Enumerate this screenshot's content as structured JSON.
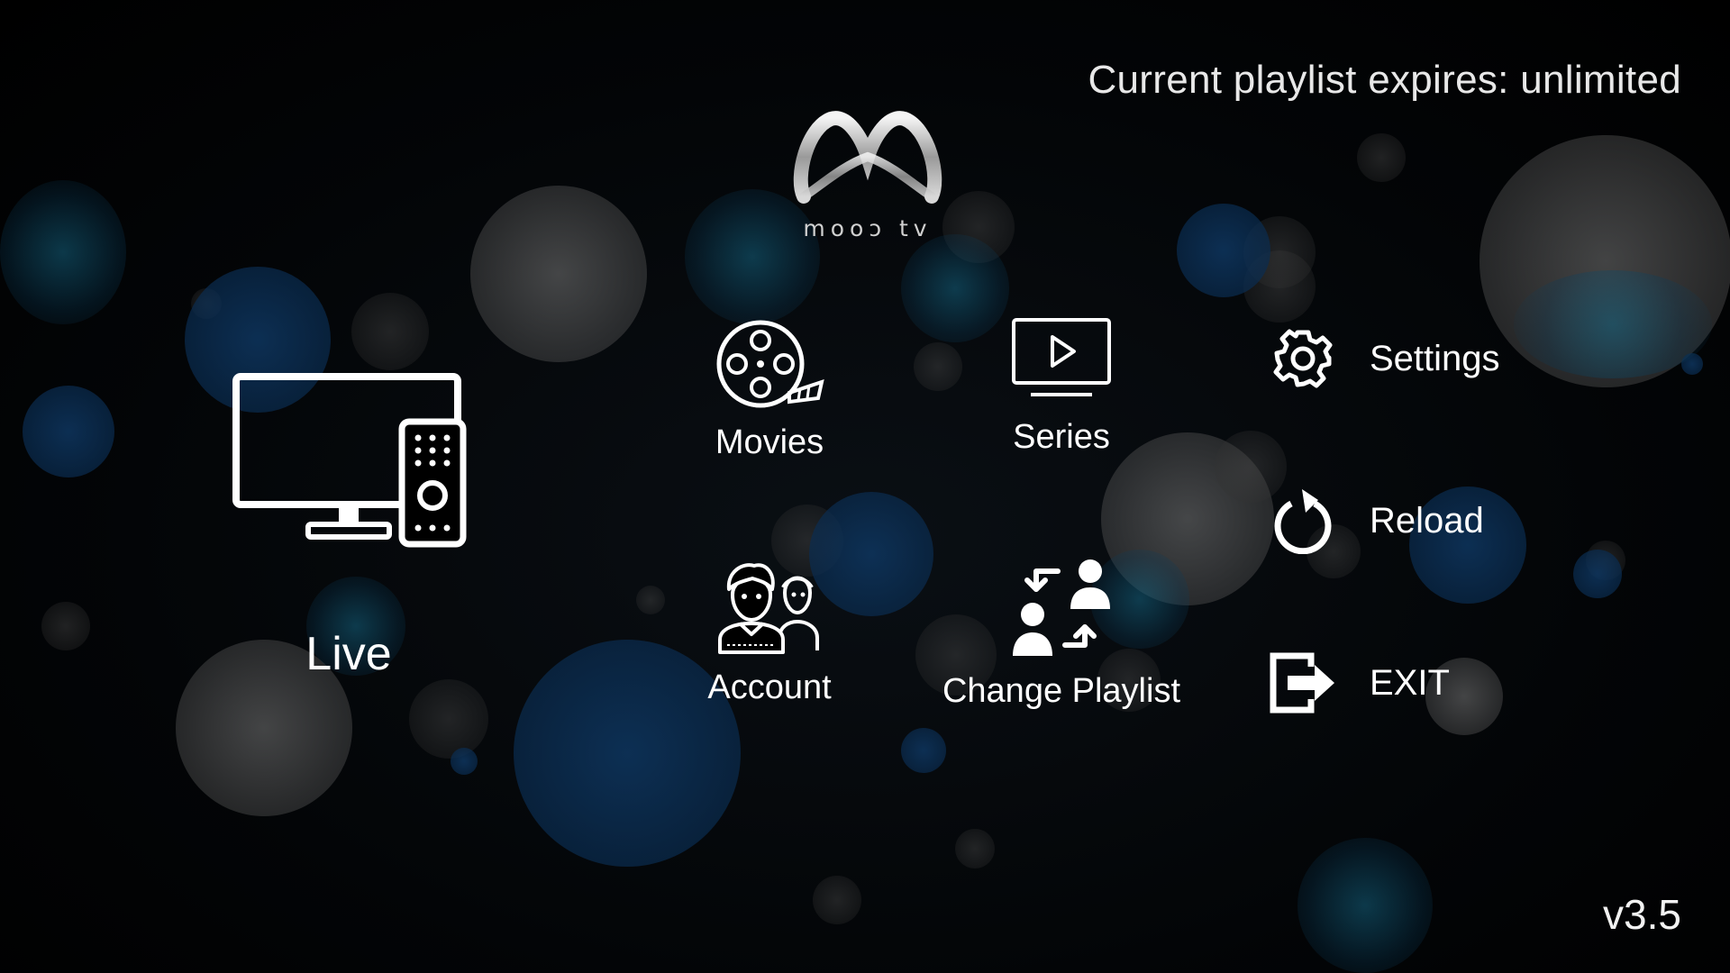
{
  "header": {
    "expires_text": "Current playlist expires: unlimited"
  },
  "logo": {
    "text": "mooↄ tv"
  },
  "menu": {
    "live": {
      "label": "Live",
      "icon": "tv-remote-icon"
    },
    "movies": {
      "label": "Movies",
      "icon": "film-reel-icon"
    },
    "series": {
      "label": "Series",
      "icon": "play-screen-icon"
    },
    "account": {
      "label": "Account",
      "icon": "users-icon"
    },
    "change_playlist": {
      "label": "Change Playlist",
      "icon": "swap-users-icon"
    }
  },
  "side_menu": {
    "settings": {
      "label": "Settings",
      "icon": "gear-icon"
    },
    "reload": {
      "label": "Reload",
      "icon": "reload-icon"
    },
    "exit": {
      "label": "EXIT",
      "icon": "exit-icon"
    }
  },
  "footer": {
    "version": "v3.5"
  },
  "colors": {
    "background": "#000000",
    "bokeh_blue": "#0e3660",
    "bokeh_gray": "#787878",
    "text": "#ffffff"
  }
}
